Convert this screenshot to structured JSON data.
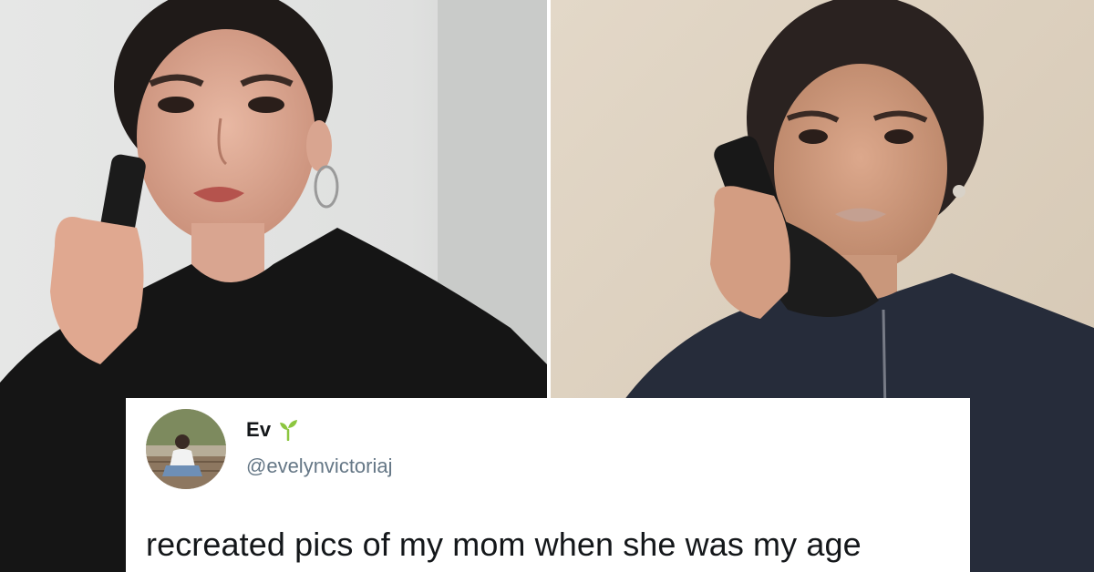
{
  "tweet": {
    "display_name": "Ev",
    "handle": "@evelynvictoriaj",
    "text": "recreated pics of my mom when she was my age"
  },
  "icons": {
    "name_badge": "sprout-icon"
  },
  "colors": {
    "tweet_background": "#ffffff",
    "name_text": "#14171a",
    "handle_text": "#657786",
    "sprout": "#8cc63f"
  }
}
